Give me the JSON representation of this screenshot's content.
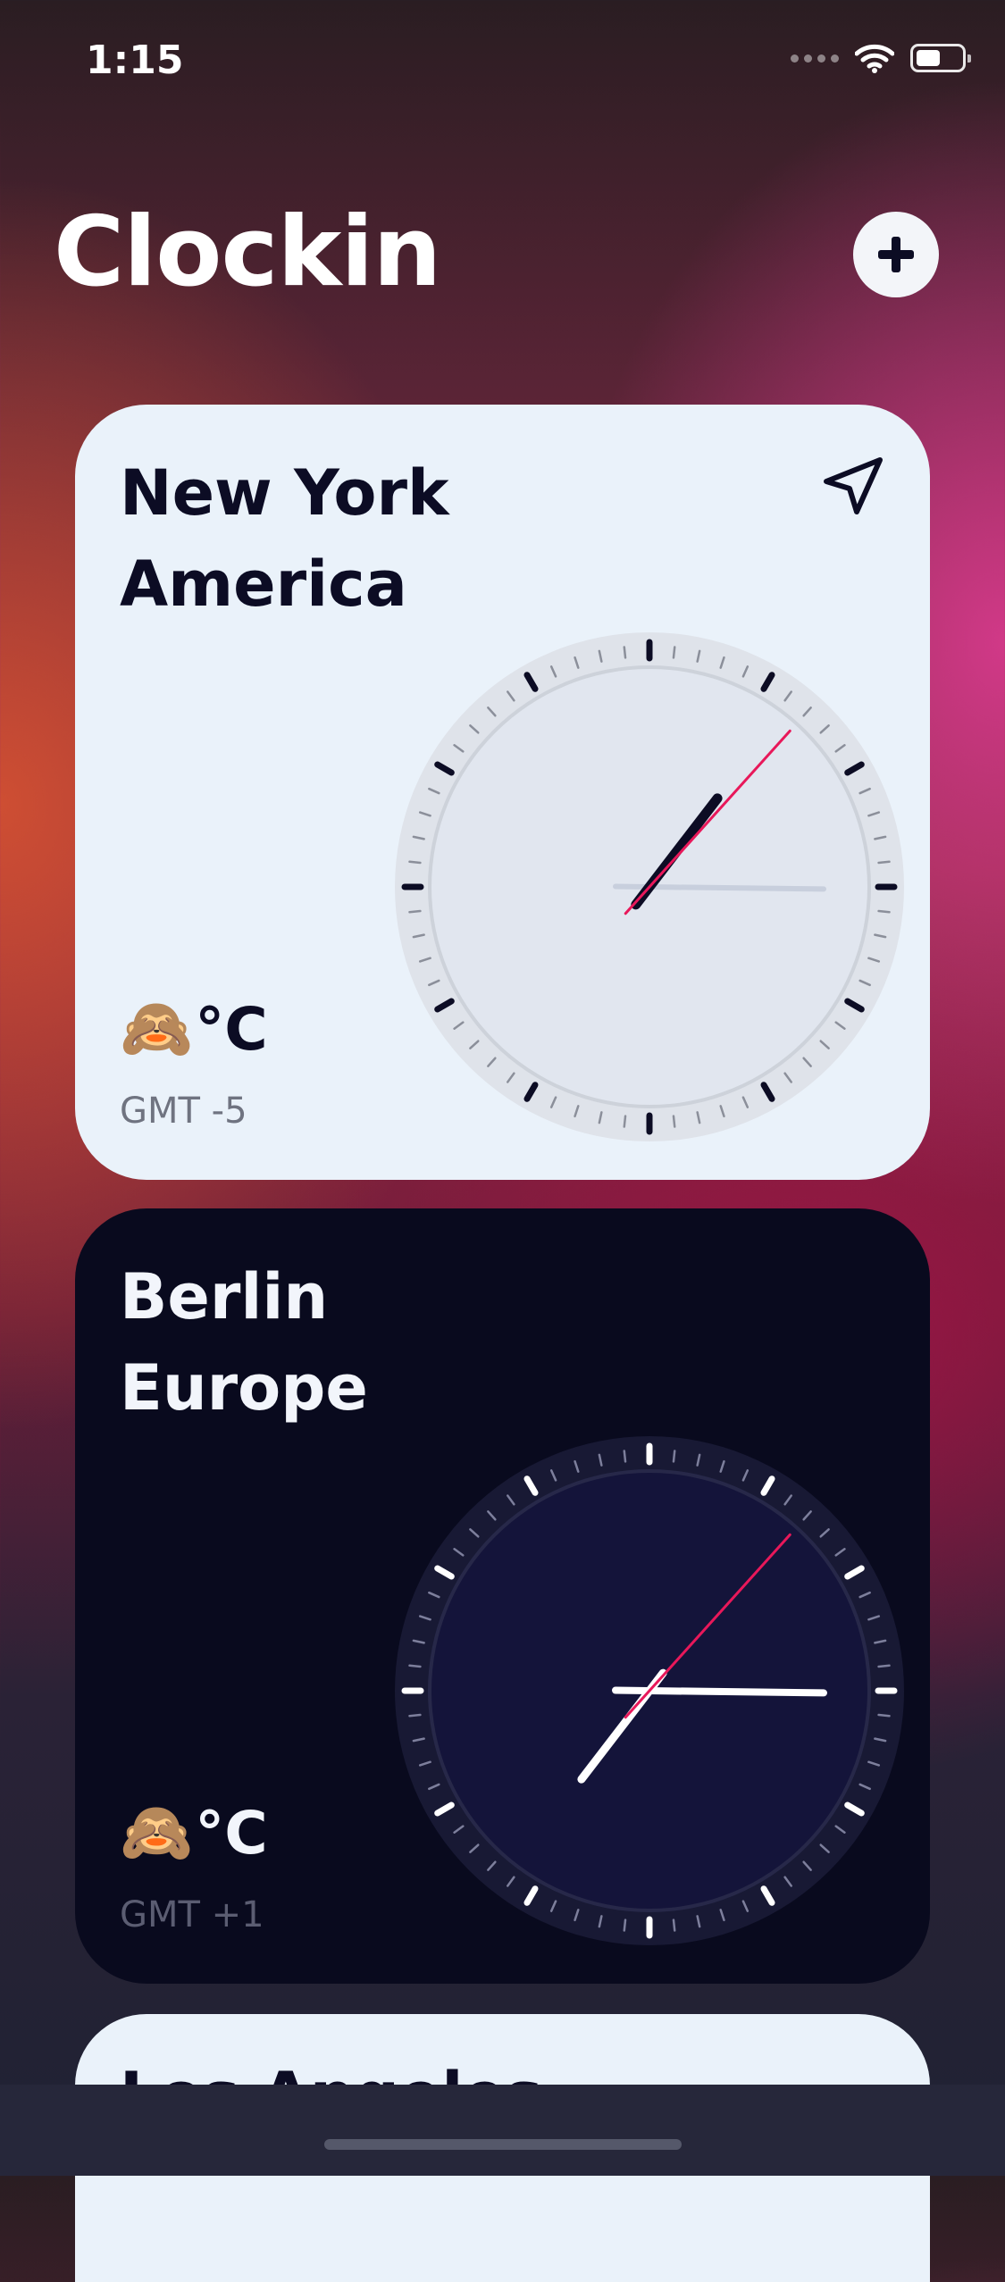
{
  "status_bar": {
    "time": "1:15",
    "battery_level": 0.55,
    "icons": [
      "signal-icon",
      "wifi-icon",
      "battery-icon"
    ]
  },
  "header": {
    "title": "Clockin",
    "add_button_icon": "plus-icon"
  },
  "cards": [
    {
      "theme": "light",
      "city": "New York",
      "region": "America",
      "weather_emoji": "🙈",
      "temperature_unit": "°C",
      "gmt": "GMT -5",
      "show_location_icon": true,
      "time": {
        "hour": 1,
        "minute": 15,
        "second": 7
      },
      "colors": {
        "background": "#eaf2fa",
        "text": "#0c0c24",
        "second_hand": "#e8185a"
      }
    },
    {
      "theme": "dark",
      "city": "Berlin",
      "region": "Europe",
      "weather_emoji": "🙈",
      "temperature_unit": "°C",
      "gmt": "GMT +1",
      "show_location_icon": false,
      "time": {
        "hour": 7,
        "minute": 15,
        "second": 7
      },
      "colors": {
        "background": "#090a1e",
        "text": "#f2f5fb",
        "second_hand": "#e8185a"
      }
    }
  ],
  "peek_card": {
    "title": "Los Angeles"
  }
}
